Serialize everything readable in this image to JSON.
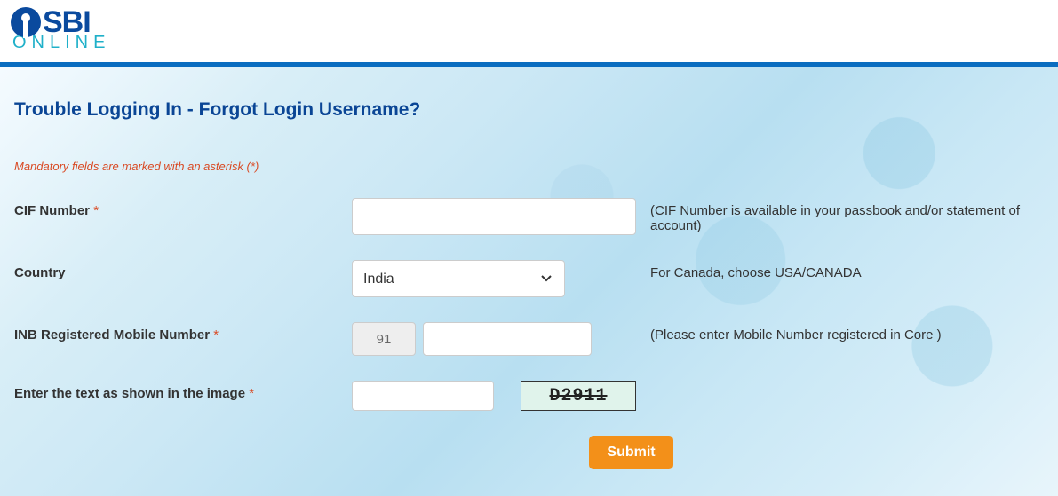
{
  "logo": {
    "brand": "SBI",
    "sub": "ONLINE"
  },
  "page": {
    "title": "Trouble Logging In - Forgot Login Username?",
    "mandatory_note": "Mandatory fields are marked with an asterisk (*)"
  },
  "form": {
    "cif": {
      "label": "CIF Number",
      "value": "",
      "hint": "(CIF Number is available in your passbook and/or statement of account)"
    },
    "country": {
      "label": "Country",
      "selected": "India",
      "hint": "For Canada, choose USA/CANADA"
    },
    "mobile": {
      "label": "INB Registered Mobile Number",
      "cc": "91",
      "value": "",
      "hint": "(Please enter Mobile Number registered in Core )"
    },
    "captcha": {
      "label": "Enter the text as shown in the image",
      "value": "",
      "image_text": "D2911"
    },
    "submit_label": "Submit"
  }
}
